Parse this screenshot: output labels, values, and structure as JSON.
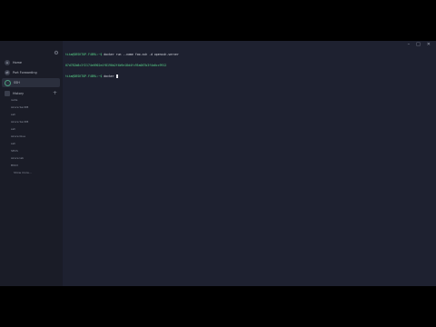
{
  "sidebar": {
    "nav": [
      {
        "label": "Home",
        "icon": "home-icon"
      },
      {
        "label": "Port Forwarding",
        "icon": "port-forward-icon"
      },
      {
        "label": "SSH",
        "icon": "terminal-icon"
      }
    ],
    "history_title": "History",
    "history": [
      "redis",
      "Azure SecDB",
      "ssh",
      "Azure SecDB",
      "ssh",
      "Azure blue",
      "ssh",
      "SECS",
      "Azure lab",
      "BSS3"
    ],
    "more_label": "Show more..."
  },
  "terminal": {
    "lines": [
      {
        "prompt": "tika@DESKTOP-F4BRL:~$",
        "command": " docker run --name foo-ssh -d openssh-server"
      },
      {
        "prompt": "",
        "command": "07d782b8c3f2174e6902e4f8190b2f4b9e18d4fc95a067b3f4a0cc9912"
      },
      {
        "prompt": "tika@DESKTOP-F4BRL:~$",
        "command": " docker "
      }
    ]
  },
  "colors": {
    "background": "#1e2130",
    "sidebar": "#1a1c27",
    "prompt": "#5ad68a"
  }
}
